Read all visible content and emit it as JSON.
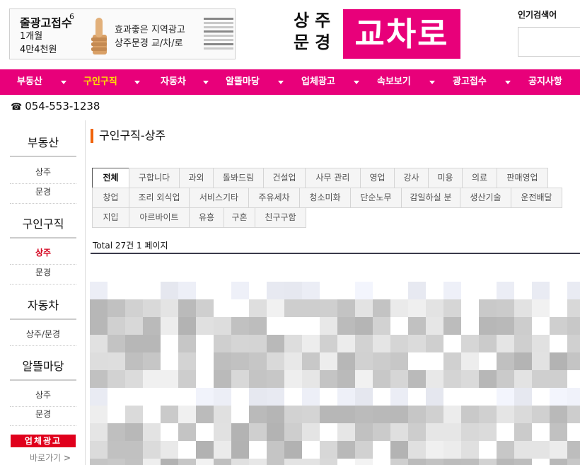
{
  "ad": {
    "number": "6",
    "line1": "줄광고접수",
    "line2": "1개월",
    "line3": "4만4천원",
    "slogan1": "효과좋은 지역광고",
    "slogan2": "상주문경 교/차/로"
  },
  "logo": {
    "words_top": "상주",
    "words_bottom": "문경",
    "brand": "교차로",
    "brand_color": "#e8007a"
  },
  "search": {
    "hot_label": "인기검색어",
    "placeholder": ""
  },
  "nav": {
    "items": [
      {
        "label": "부동산"
      },
      {
        "label": "구인구직",
        "active": true
      },
      {
        "label": "자동차"
      },
      {
        "label": "알뜰마당"
      },
      {
        "label": "업체광고"
      },
      {
        "label": "속보보기"
      },
      {
        "label": "광고접수"
      },
      {
        "label": "공지사항"
      }
    ]
  },
  "phone": {
    "icon": "telephone-icon",
    "number": "054-553-1238"
  },
  "sidebar": {
    "sections": [
      {
        "title": "부동산",
        "links": [
          "상주",
          "문경"
        ]
      },
      {
        "title": "구인구직",
        "links": [
          "상주",
          "문경"
        ],
        "active_link": "상주"
      },
      {
        "title": "자동차",
        "links": [
          "상주/문경"
        ]
      },
      {
        "title": "알뜰마당",
        "links": [
          "상주",
          "문경"
        ]
      }
    ],
    "biz_button": "업체광고",
    "biz_go": "바로가기"
  },
  "main": {
    "title": "구인구직-상주",
    "categories": [
      [
        "전체",
        "구합니다",
        "과외",
        "돌봐드림",
        "건설업",
        "사무 관리",
        "영업",
        "강사",
        "미용",
        "의료",
        "판매영업"
      ],
      [
        "창업",
        "조리 외식업",
        "서비스기타",
        "주유세차",
        "청소미화",
        "단순노무",
        "감일하실 분",
        "생산기술",
        "운전배달"
      ],
      [
        "지입",
        "아르바이트",
        "유흥",
        "구혼",
        "친구구함"
      ]
    ],
    "active_category": "전체",
    "total": "Total 27건 1 페이지"
  }
}
